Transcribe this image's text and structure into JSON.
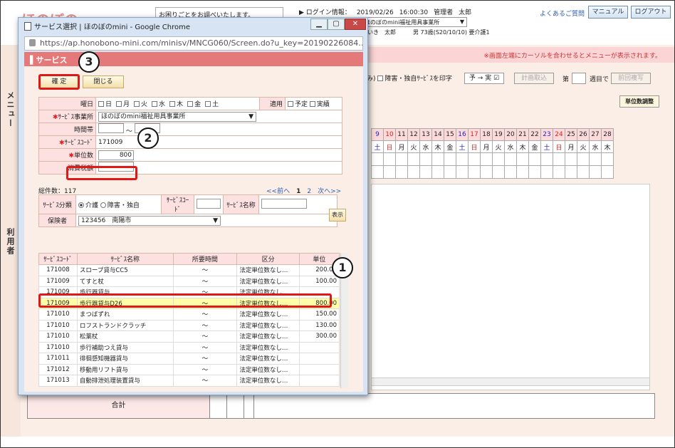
{
  "header": {
    "logo_text": "ほのぼの",
    "notice": "お困りごとをお調べいたします。",
    "login_label": "ログイン情報：",
    "login_date": "2019/02/26",
    "login_time": "16:00:30",
    "login_role": "管理者",
    "login_user": "太郎",
    "faq_link": "よくあるご質問",
    "manual_btn": "マニュアル",
    "logout_btn": "ログアウト",
    "office_select": "ほのぼのmini福祉用具事業所",
    "client_name": "さいき　太郎",
    "client_info": "男 73歳(S20/10/10) 要介護1"
  },
  "main": {
    "pink_notice": "※画面左端にカーソルを合わせるとメニューが表示されます。",
    "side_menu": "メニュー",
    "side_user": "利用者",
    "opt_text": "み)",
    "opt_disabled_print": "障害・独自ｻｰﾋﾞｽを印字",
    "plan_to_actual": "予 → 実",
    "plan_import": "計画取込",
    "week_prefix": "第",
    "week_suffix": "週目で",
    "copy_prev": "前回複写",
    "unit_adjust": "単位数調整",
    "days": [
      "9",
      "10",
      "11",
      "12",
      "13",
      "14",
      "15",
      "16",
      "17",
      "18",
      "19",
      "20",
      "21",
      "22",
      "23",
      "24",
      "25",
      "26",
      "27",
      "28"
    ],
    "dows": [
      "土",
      "日",
      "月",
      "火",
      "水",
      "木",
      "金",
      "土",
      "日",
      "月",
      "火",
      "水",
      "木",
      "金",
      "土",
      "日",
      "月",
      "火",
      "水",
      "木"
    ],
    "total_label": "合計"
  },
  "popup": {
    "title": "サービス選択 | ほのぼのmini - Google Chrome",
    "url": "https://ap.honobono-mini.com/minisv/MNCG060/Screen.do?u_key=20190226084…",
    "heading": "サービス",
    "confirm_btn": "確 定",
    "close_btn": "閉じる",
    "form": {
      "dow_label": "曜日",
      "dows": [
        "日",
        "月",
        "火",
        "水",
        "木",
        "金",
        "土"
      ],
      "apply_label": "適用",
      "apply_plan": "予定",
      "apply_actual": "実績",
      "office_label": "ｻｰﾋﾞｽ事業所",
      "office_value": "ほのぼのmini福祉用具事業所",
      "time_label": "時間帯",
      "time_sep": "～",
      "code_label": "ｻｰﾋﾞｽｺｰﾄﾞ",
      "code_value": "171009",
      "units_label": "単位数",
      "units_value": "800",
      "tax_label": "消費税額"
    },
    "total_count": "総件数：117",
    "pager": [
      "<<前へ",
      "1",
      "2",
      "次へ>>"
    ],
    "search": {
      "type_label": "ｻｰﾋﾞｽ分類",
      "type_care": "介護",
      "type_disabled": "障害・独自",
      "code_label": "ｻｰﾋﾞｽｺｰﾄﾞ",
      "name_label": "ｻｰﾋﾞｽ名称",
      "insurer_label": "保険者",
      "insurer_value": "123456　南陽市",
      "show_btn": "表示"
    },
    "columns": [
      "ｻｰﾋﾞｽｺｰﾄﾞ",
      "ｻｰﾋﾞｽ名称",
      "所要時間",
      "区分",
      "単位"
    ],
    "rows": [
      {
        "code": "171008",
        "name": "スロープ貸与CC5",
        "time": "～",
        "kubun": "法定単位数なし…",
        "unit": "200.00"
      },
      {
        "code": "171009",
        "name": "てすと杖",
        "time": "～",
        "kubun": "法定単位数なし…",
        "unit": "100.00"
      },
      {
        "code": "171009",
        "name": "歩行器貸与",
        "time": "～",
        "kubun": "法定単位数なし…",
        "unit": ""
      },
      {
        "code": "171009",
        "name": "歩行器貸与D26",
        "time": "～",
        "kubun": "法定単位数なし…",
        "unit": "800.00"
      },
      {
        "code": "171010",
        "name": "まつばずれ",
        "time": "～",
        "kubun": "法定単位数なし…",
        "unit": "150.00"
      },
      {
        "code": "171010",
        "name": "ロフストランドクラッチ",
        "time": "～",
        "kubun": "法定単位数なし…",
        "unit": "130.00"
      },
      {
        "code": "171010",
        "name": "松葉杖",
        "time": "～",
        "kubun": "法定単位数なし…",
        "unit": "300.00"
      },
      {
        "code": "171010",
        "name": "歩行補助つえ貸与",
        "time": "～",
        "kubun": "法定単位数なし…",
        "unit": ""
      },
      {
        "code": "171011",
        "name": "徘徊感知機器貸与",
        "time": "～",
        "kubun": "法定単位数なし…",
        "unit": ""
      },
      {
        "code": "171012",
        "name": "移動用リフト貸与",
        "time": "～",
        "kubun": "法定単位数なし…",
        "unit": ""
      },
      {
        "code": "171013",
        "name": "自動排泄処理装置貸与",
        "time": "～",
        "kubun": "法定単位数なし…",
        "unit": ""
      }
    ]
  },
  "annotations": {
    "a1": "1",
    "a2": "2",
    "a3": "3"
  },
  "colors": {
    "highlight": "#e01818",
    "pink": "#fbd5d5",
    "header": "#e57878"
  }
}
